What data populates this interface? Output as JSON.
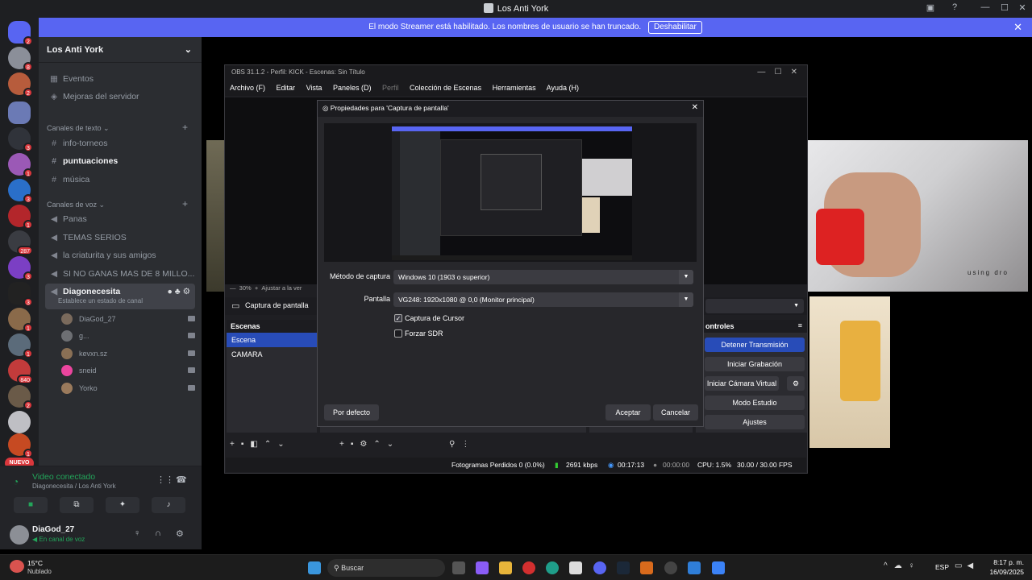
{
  "window": {
    "title": "Los Anti York"
  },
  "banner": {
    "text": "El modo Streamer está habilitado. Los nombres de usuario se han truncado.",
    "button": "Deshabilitar"
  },
  "rail": {
    "badges": [
      "2",
      "8",
      "2",
      "3",
      "1",
      "3",
      "1",
      "3",
      "3",
      "1",
      "1",
      "287",
      "1",
      "3",
      "840",
      "2"
    ],
    "new_label": "NUEVO"
  },
  "sidebar": {
    "server_name": "Los Anti York",
    "top_items": [
      {
        "icon": "calendar-icon",
        "label": "Eventos"
      },
      {
        "icon": "boost-icon",
        "label": "Mejoras del servidor"
      }
    ],
    "text_category": "Canales de texto",
    "text_channels": [
      {
        "label": "info-torneos"
      },
      {
        "label": "puntuaciones"
      },
      {
        "label": "música"
      }
    ],
    "voice_category": "Canales de voz",
    "voice_channels": [
      {
        "label": "Panas"
      },
      {
        "label": "TEMAS SERIOS"
      },
      {
        "label": "la criaturita y sus amigos"
      },
      {
        "label": "SI NO GANAS MAS DE 8 MILLO..."
      },
      {
        "label": "Diagonecesita"
      }
    ],
    "status_hint": "Establece un estado de canal",
    "voice_users": [
      {
        "name": "DiaGod_27",
        "color": "#7a6a5c"
      },
      {
        "name": "g...",
        "color": "#6d6f73"
      },
      {
        "name": "kevxn.sz",
        "color": "#8a7055"
      },
      {
        "name": "sneid",
        "color": "#eb459e"
      },
      {
        "name": "Yorko",
        "color": "#9a7a5c"
      }
    ]
  },
  "voice_panel": {
    "status": "Video conectado",
    "channel": "Diagonecesita / Los Anti York"
  },
  "user_panel": {
    "name": "DiaGod_27",
    "status": "En canal de voz"
  },
  "obs": {
    "title": "OBS 31.1.2 - Perfil: KICK - Escenas: Sin Título",
    "menu": [
      "Archivo (F)",
      "Editar",
      "Vista",
      "Paneles (D)",
      "Perfil",
      "Colección de Escenas",
      "Herramientas",
      "Ayuda (H)"
    ],
    "zoom": "30%",
    "fit_label": "Ajustar a la ver",
    "source": "Captura de pantalla",
    "scenes_header": "Escenas",
    "scenes": [
      "Escena",
      "CAMARA"
    ],
    "controls_header": "ontroles",
    "controls": [
      "Detener Transmisión",
      "Iniciar Grabación",
      "Iniciar Cámara Virtual",
      "Modo Estudio",
      "Ajustes"
    ],
    "status": {
      "dropped": "Fotogramas Perdidos 0 (0.0%)",
      "bitrate": "2691 kbps",
      "stream_time": "00:17:13",
      "rec_time": "00:00:00",
      "cpu": "CPU: 1.5%",
      "fps": "30.00 / 30.00 FPS"
    }
  },
  "dialog": {
    "title": "Propiedades para 'Captura de pantalla'",
    "method_label": "Método de captura",
    "method_value": "Windows 10 (1903 o superior)",
    "display_label": "Pantalla",
    "display_value": "VG248: 1920x1080 @ 0,0 (Monitor principal)",
    "cursor_label": "Captura de Cursor",
    "sdr_label": "Forzar SDR",
    "defaults_button": "Por defecto",
    "ok_button": "Aceptar",
    "cancel_button": "Cancelar"
  },
  "webcam": {
    "overlay_text": "using dro"
  },
  "taskbar": {
    "weather_temp": "15°C",
    "weather_desc": "Nublado",
    "search": "Buscar",
    "lang": "ESP",
    "time": "8:17 p. m.",
    "date": "16/09/2025"
  },
  "colors": {
    "discord_blurple": "#5865f2",
    "obs_blue": "#284cb8",
    "voice_green": "#23a55a",
    "badge_red": "#da373c"
  }
}
